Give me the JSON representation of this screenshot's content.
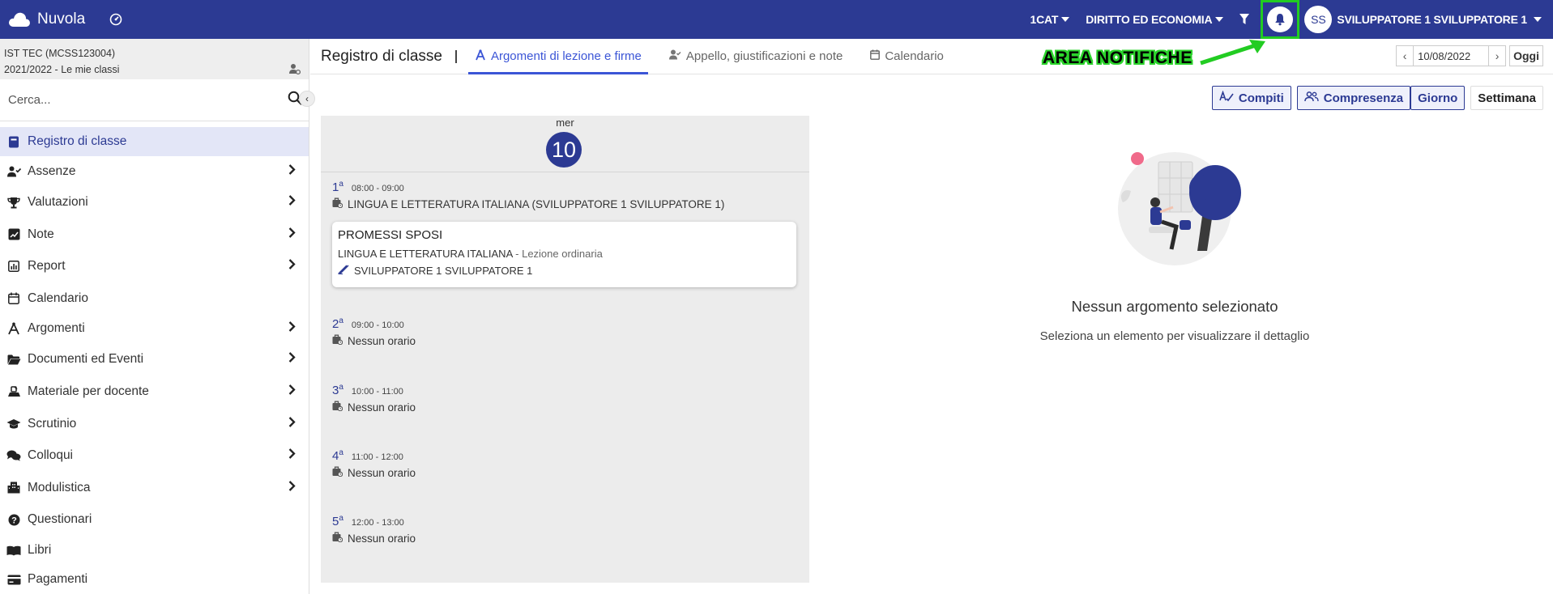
{
  "app": {
    "name": "Nuvola"
  },
  "topbar": {
    "class_dd": "1CAT",
    "subject_dd": "DIRITTO ED ECONOMIA",
    "avatar_initials": "SS",
    "user_name": "SVILUPPATORE 1 SVILUPPATORE 1",
    "accent_color": "#2c3a93"
  },
  "sidebar": {
    "school_line1": "IST TEC (MCSS123004)",
    "school_line2": "2021/2022 - Le mie classi",
    "search_placeholder": "Cerca...",
    "items": [
      {
        "label": "Registro di classe",
        "icon": "book-icon",
        "active": true,
        "chevron": false
      },
      {
        "label": "Assenze",
        "icon": "user-check-icon",
        "chevron": true
      },
      {
        "label": "Valutazioni",
        "icon": "trophy-icon",
        "chevron": true
      },
      {
        "label": "Note",
        "icon": "note-icon",
        "chevron": true
      },
      {
        "label": "Report",
        "icon": "chart-icon",
        "chevron": true
      },
      {
        "label": "Calendario",
        "icon": "calendar-icon",
        "chevron": false
      },
      {
        "label": "Argomenti",
        "icon": "compass-icon",
        "chevron": true
      },
      {
        "label": "Documenti ed Eventi",
        "icon": "folder-icon",
        "chevron": true
      },
      {
        "label": "Materiale per docente",
        "icon": "materials-icon",
        "chevron": true
      },
      {
        "label": "Scrutinio",
        "icon": "graduation-cap-icon",
        "chevron": true
      },
      {
        "label": "Colloqui",
        "icon": "chat-icon",
        "chevron": true
      },
      {
        "label": "Modulistica",
        "icon": "building-icon",
        "chevron": true
      },
      {
        "label": "Questionari",
        "icon": "question-icon",
        "chevron": false
      },
      {
        "label": "Libri",
        "icon": "open-book-icon",
        "chevron": false
      },
      {
        "label": "Pagamenti",
        "icon": "credit-card-icon",
        "chevron": false
      }
    ]
  },
  "subheader": {
    "title": "Registro di classe",
    "tabs": [
      {
        "label": "Argomenti di lezione e firme",
        "icon": "compass-icon",
        "active": true
      },
      {
        "label": "Appello, giustificazioni e note",
        "icon": "user-check-icon",
        "active": false
      },
      {
        "label": "Calendario",
        "icon": "calendar-icon",
        "active": false
      }
    ],
    "annotation": "AREA NOTIFICHE",
    "date": "10/08/2022",
    "today_label": "Oggi"
  },
  "view_buttons": {
    "compiti": "Compiti",
    "compresenza": "Compresenza",
    "giorno": "Giorno",
    "settimana": "Settimana"
  },
  "day": {
    "dow": "mer",
    "num": "10",
    "hours": [
      {
        "n": "1",
        "time": "08:00 - 09:00",
        "sub": "LINGUA E LETTERATURA ITALIANA (SVILUPPATORE 1 SVILUPPATORE 1)"
      },
      {
        "n": "2",
        "time": "09:00 - 10:00",
        "sub": "Nessun orario"
      },
      {
        "n": "3",
        "time": "10:00 - 11:00",
        "sub": "Nessun orario"
      },
      {
        "n": "4",
        "time": "11:00 - 12:00",
        "sub": "Nessun orario"
      },
      {
        "n": "5",
        "time": "12:00 - 13:00",
        "sub": "Nessun orario"
      }
    ],
    "hour_suffix": "a",
    "lesson": {
      "title": "PROMESSI SPOSI",
      "subject": "LINGUA E LETTERATURA ITALIANA",
      "kind": " - Lezione ordinaria",
      "teacher": "SVILUPPATORE 1 SVILUPPATORE 1"
    }
  },
  "empty_state": {
    "title": "Nessun argomento selezionato",
    "subtitle": "Seleziona un elemento per visualizzare il dettaglio"
  }
}
